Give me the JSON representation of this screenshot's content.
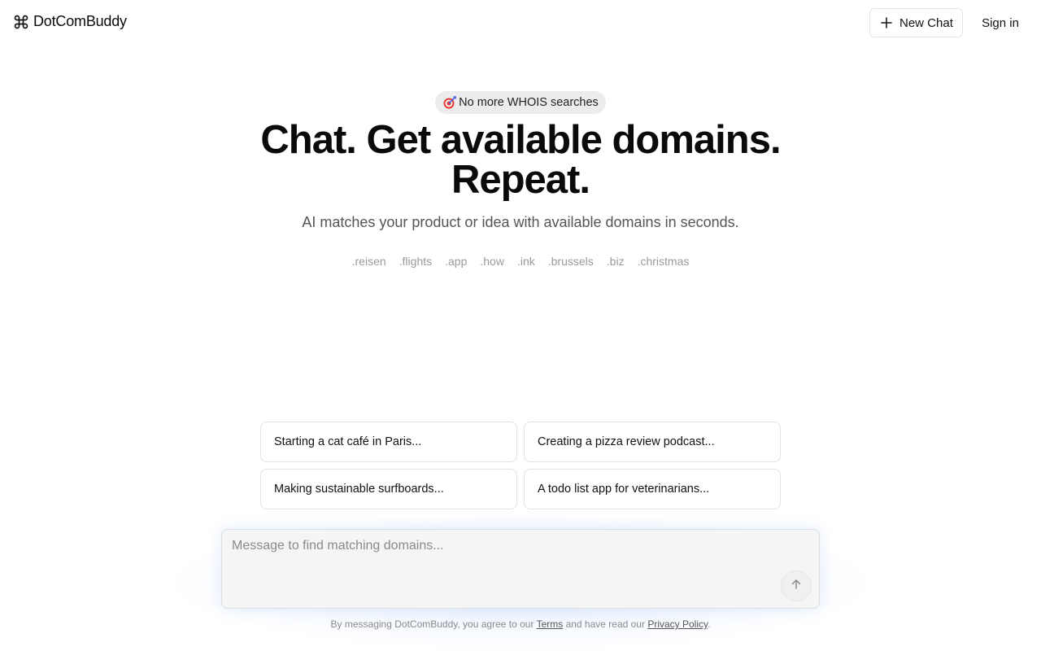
{
  "header": {
    "logo_icon": "command-icon",
    "brand": "DotComBuddy",
    "new_chat_label": "New Chat",
    "new_chat_icon": "plus-icon",
    "sign_in_label": "Sign in"
  },
  "hero": {
    "badge_icon": "target-dart-icon",
    "badge_text": "No more WHOIS searches",
    "title_line1": "Chat. Get available domains.",
    "title_line2": "Repeat.",
    "subtitle": "AI matches your product or idea with available domains in seconds.",
    "tlds": [
      ".reisen",
      ".flights",
      ".app",
      ".how",
      ".ink",
      ".brussels",
      ".biz",
      ".christmas"
    ]
  },
  "suggestions": [
    "Starting a cat café in Paris...",
    "Creating a pizza review podcast...",
    "Making sustainable surfboards...",
    "A todo list app for veterinarians..."
  ],
  "composer": {
    "placeholder": "Message to find matching domains...",
    "send_icon": "arrow-up-icon"
  },
  "footer": {
    "prefix": "By messaging DotComBuddy, you agree to our ",
    "terms": "Terms",
    "middle": " and have read our ",
    "privacy": "Privacy Policy",
    "suffix": "."
  },
  "colors": {
    "text": "#0b0b0b",
    "muted": "#555555",
    "tld": "#9a9a9a",
    "badge_bg": "#ececec",
    "border": "#e3e3e6",
    "glow": "#aac8ff"
  }
}
